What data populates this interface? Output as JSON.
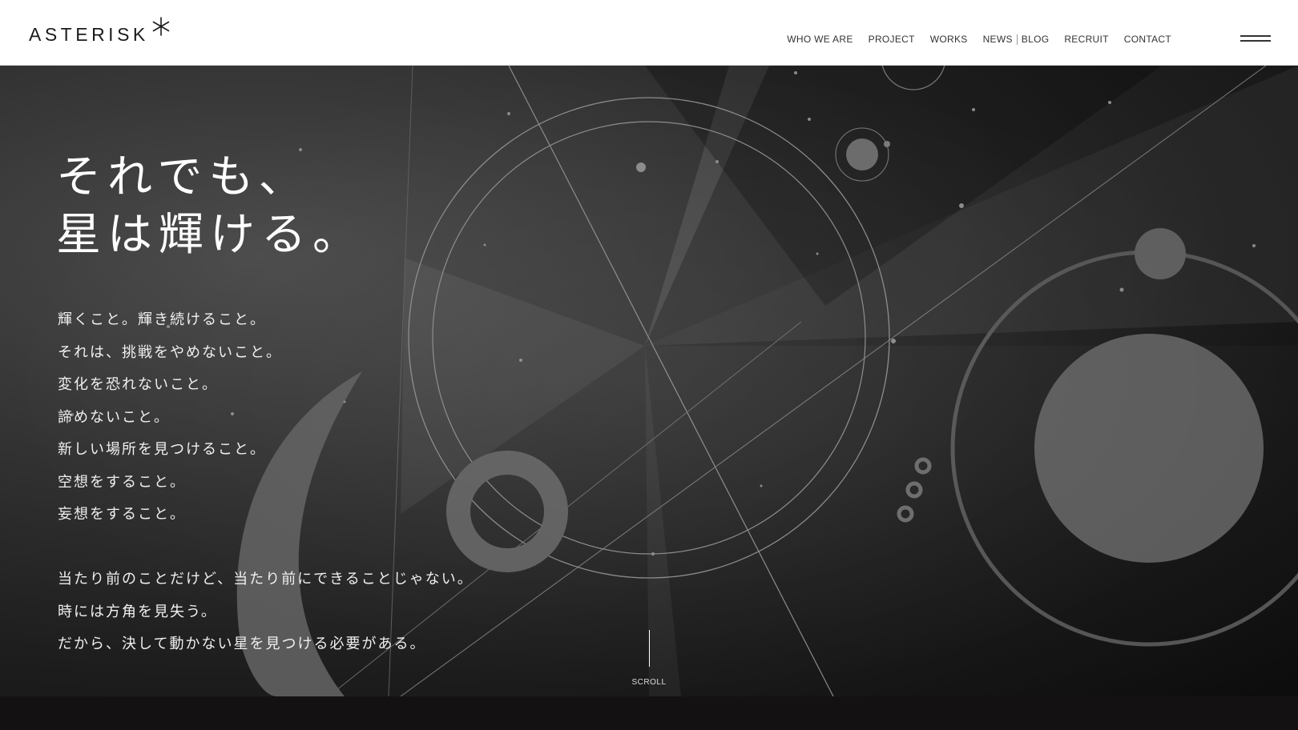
{
  "header": {
    "logo_text": "ASTERISK",
    "nav": {
      "who_we_are": "WHO WE ARE",
      "project": "PROJECT",
      "works": "WORKS",
      "news": "NEWS",
      "blog": "BLOG",
      "recruit": "RECRUIT",
      "contact": "CONTACT"
    }
  },
  "hero": {
    "headline": [
      "それでも、",
      "星は輝ける。"
    ],
    "paragraph1": [
      "輝くこと。輝き続けること。",
      "それは、挑戦をやめないこと。",
      "変化を恐れないこと。",
      "諦めないこと。",
      "新しい場所を見つけること。",
      "空想をすること。",
      "妄想をすること。"
    ],
    "paragraph2": [
      "当たり前のことだけど、当たり前にできることじゃない。",
      "時には方角を見失う。",
      "だから、決して動かない星を見つける必要がある。"
    ],
    "scroll_label": "SCROLL"
  },
  "colors": {
    "header_bg": "#ffffff",
    "hero_text": "#ffffff",
    "shape_gray": "#5a5a5a",
    "bottom_band": "#141113"
  },
  "icons": {
    "logo_mark": "asterisk-icon",
    "menu": "hamburger-menu-icon"
  }
}
